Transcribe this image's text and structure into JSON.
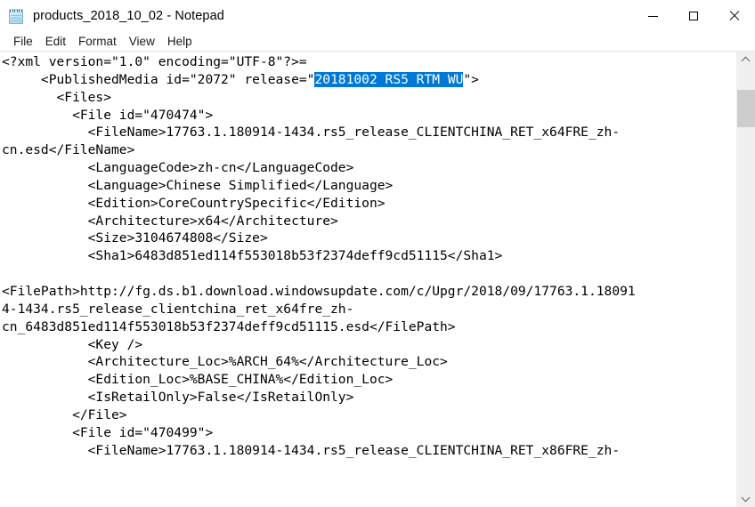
{
  "window": {
    "title": "products_2018_10_02 - Notepad",
    "icon": "notepad-icon",
    "controls": {
      "minimize": "Minimize",
      "maximize": "Maximize",
      "close": "Close"
    }
  },
  "menubar": {
    "items": [
      {
        "label": "File"
      },
      {
        "label": "Edit"
      },
      {
        "label": "Format"
      },
      {
        "label": "View"
      },
      {
        "label": "Help"
      }
    ]
  },
  "selection": {
    "text": "20181002 RS5 RTM WU",
    "highlight_color": "#0078d7",
    "text_color": "#ffffff"
  },
  "editor": {
    "font": "monospace",
    "background_color": "#ffffff",
    "text_color": "#000000",
    "lines": [
      {
        "id": "l1",
        "segments": [
          {
            "text": "<?xml version=\"1.0\" encoding=\"UTF-8\"?>="
          }
        ]
      },
      {
        "id": "l2",
        "segments": [
          {
            "text": "     <PublishedMedia id=\"2072\" release=\""
          },
          {
            "text": "20181002 RS5 RTM WU",
            "selected": true
          },
          {
            "text": "\">"
          }
        ]
      },
      {
        "id": "l3",
        "segments": [
          {
            "text": "       <Files>"
          }
        ]
      },
      {
        "id": "l4",
        "segments": [
          {
            "text": "         <File id=\"470474\">"
          }
        ]
      },
      {
        "id": "l5",
        "segments": [
          {
            "text": "           <FileName>17763.1.180914-1434.rs5_release_CLIENTCHINA_RET_x64FRE_zh-"
          }
        ]
      },
      {
        "id": "l6",
        "segments": [
          {
            "text": "cn.esd</FileName>"
          }
        ]
      },
      {
        "id": "l7",
        "segments": [
          {
            "text": "           <LanguageCode>zh-cn</LanguageCode>"
          }
        ]
      },
      {
        "id": "l8",
        "segments": [
          {
            "text": "           <Language>Chinese Simplified</Language>"
          }
        ]
      },
      {
        "id": "l9",
        "segments": [
          {
            "text": "           <Edition>CoreCountrySpecific</Edition>"
          }
        ]
      },
      {
        "id": "l10",
        "segments": [
          {
            "text": "           <Architecture>x64</Architecture>"
          }
        ]
      },
      {
        "id": "l11",
        "segments": [
          {
            "text": "           <Size>3104674808</Size>"
          }
        ]
      },
      {
        "id": "l12",
        "segments": [
          {
            "text": "           <Sha1>6483d851ed114f553018b53f2374deff9cd51115</Sha1>"
          }
        ]
      },
      {
        "id": "l13",
        "segments": [
          {
            "text": ""
          }
        ]
      },
      {
        "id": "l14",
        "segments": [
          {
            "text": "<FilePath>http://fg.ds.b1.download.windowsupdate.com/c/Upgr/2018/09/17763.1.18091"
          }
        ]
      },
      {
        "id": "l15",
        "segments": [
          {
            "text": "4-1434.rs5_release_clientchina_ret_x64fre_zh-"
          }
        ]
      },
      {
        "id": "l16",
        "segments": [
          {
            "text": "cn_6483d851ed114f553018b53f2374deff9cd51115.esd</FilePath>"
          }
        ]
      },
      {
        "id": "l17",
        "segments": [
          {
            "text": "           <Key />"
          }
        ]
      },
      {
        "id": "l18",
        "segments": [
          {
            "text": "           <Architecture_Loc>%ARCH_64%</Architecture_Loc>"
          }
        ]
      },
      {
        "id": "l19",
        "segments": [
          {
            "text": "           <Edition_Loc>%BASE_CHINA%</Edition_Loc>"
          }
        ]
      },
      {
        "id": "l20",
        "segments": [
          {
            "text": "           <IsRetailOnly>False</IsRetailOnly>"
          }
        ]
      },
      {
        "id": "l21",
        "segments": [
          {
            "text": "         </File>"
          }
        ]
      },
      {
        "id": "l22",
        "segments": [
          {
            "text": "         <File id=\"470499\">"
          }
        ]
      },
      {
        "id": "l23",
        "segments": [
          {
            "text": "           <FileName>17763.1.180914-1434.rs5_release_CLIENTCHINA_RET_x86FRE_zh-"
          }
        ]
      }
    ]
  },
  "scrollbar": {
    "orientation": "vertical",
    "up_arrow": "scroll-up",
    "down_arrow": "scroll-down",
    "thumb_top_pct": 5,
    "thumb_height_pct": 9,
    "track_color": "#f0f0f0",
    "thumb_color": "#cdcdcd"
  }
}
